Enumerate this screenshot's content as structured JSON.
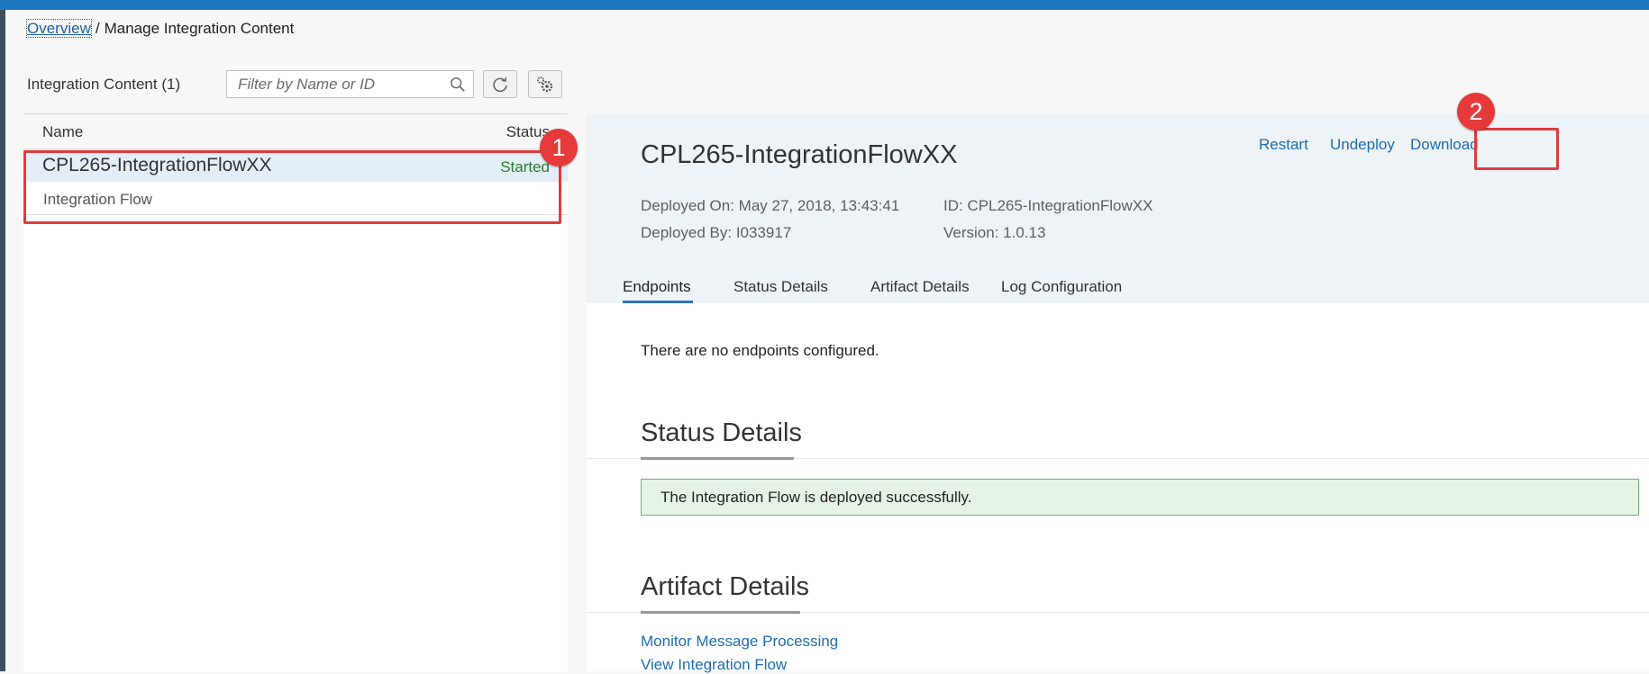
{
  "breadcrumb": {
    "home": "Overview",
    "separator": "/",
    "current": "Manage Integration Content"
  },
  "list": {
    "title": "Integration Content (1)",
    "search_placeholder": "Filter by Name or ID",
    "columns": {
      "name": "Name",
      "status": "Status"
    },
    "items": [
      {
        "name": "CPL265-IntegrationFlowXX",
        "status": "Started",
        "type": "Integration Flow"
      }
    ]
  },
  "detail": {
    "title": "CPL265-IntegrationFlowXX",
    "actions": {
      "restart": "Restart",
      "undeploy": "Undeploy",
      "download": "Download"
    },
    "meta": {
      "deployed_on": "Deployed On: May 27, 2018, 13:43:41",
      "deployed_by": "Deployed By: I033917",
      "id": "ID: CPL265-IntegrationFlowXX",
      "version": "Version: 1.0.13"
    },
    "tabs": [
      "Endpoints",
      "Status Details",
      "Artifact Details",
      "Log Configuration"
    ],
    "active_tab": "Endpoints",
    "endpoints_message": "There are no endpoints configured.",
    "status_section_title": "Status Details",
    "status_message": "The Integration Flow is deployed successfully.",
    "artifact_section_title": "Artifact Details",
    "links": [
      "Monitor Message Processing",
      "View Integration Flow"
    ]
  },
  "annotations": {
    "badge_1": "1",
    "badge_2": "2"
  },
  "colors": {
    "accent": "#1b78be",
    "link": "#1e6cb0",
    "status_started": "#2b7d2b",
    "annotation": "#e03b3b",
    "success_bg": "#e4f3e6"
  },
  "icons": [
    "search-icon",
    "refresh-icon",
    "settings-icon"
  ]
}
